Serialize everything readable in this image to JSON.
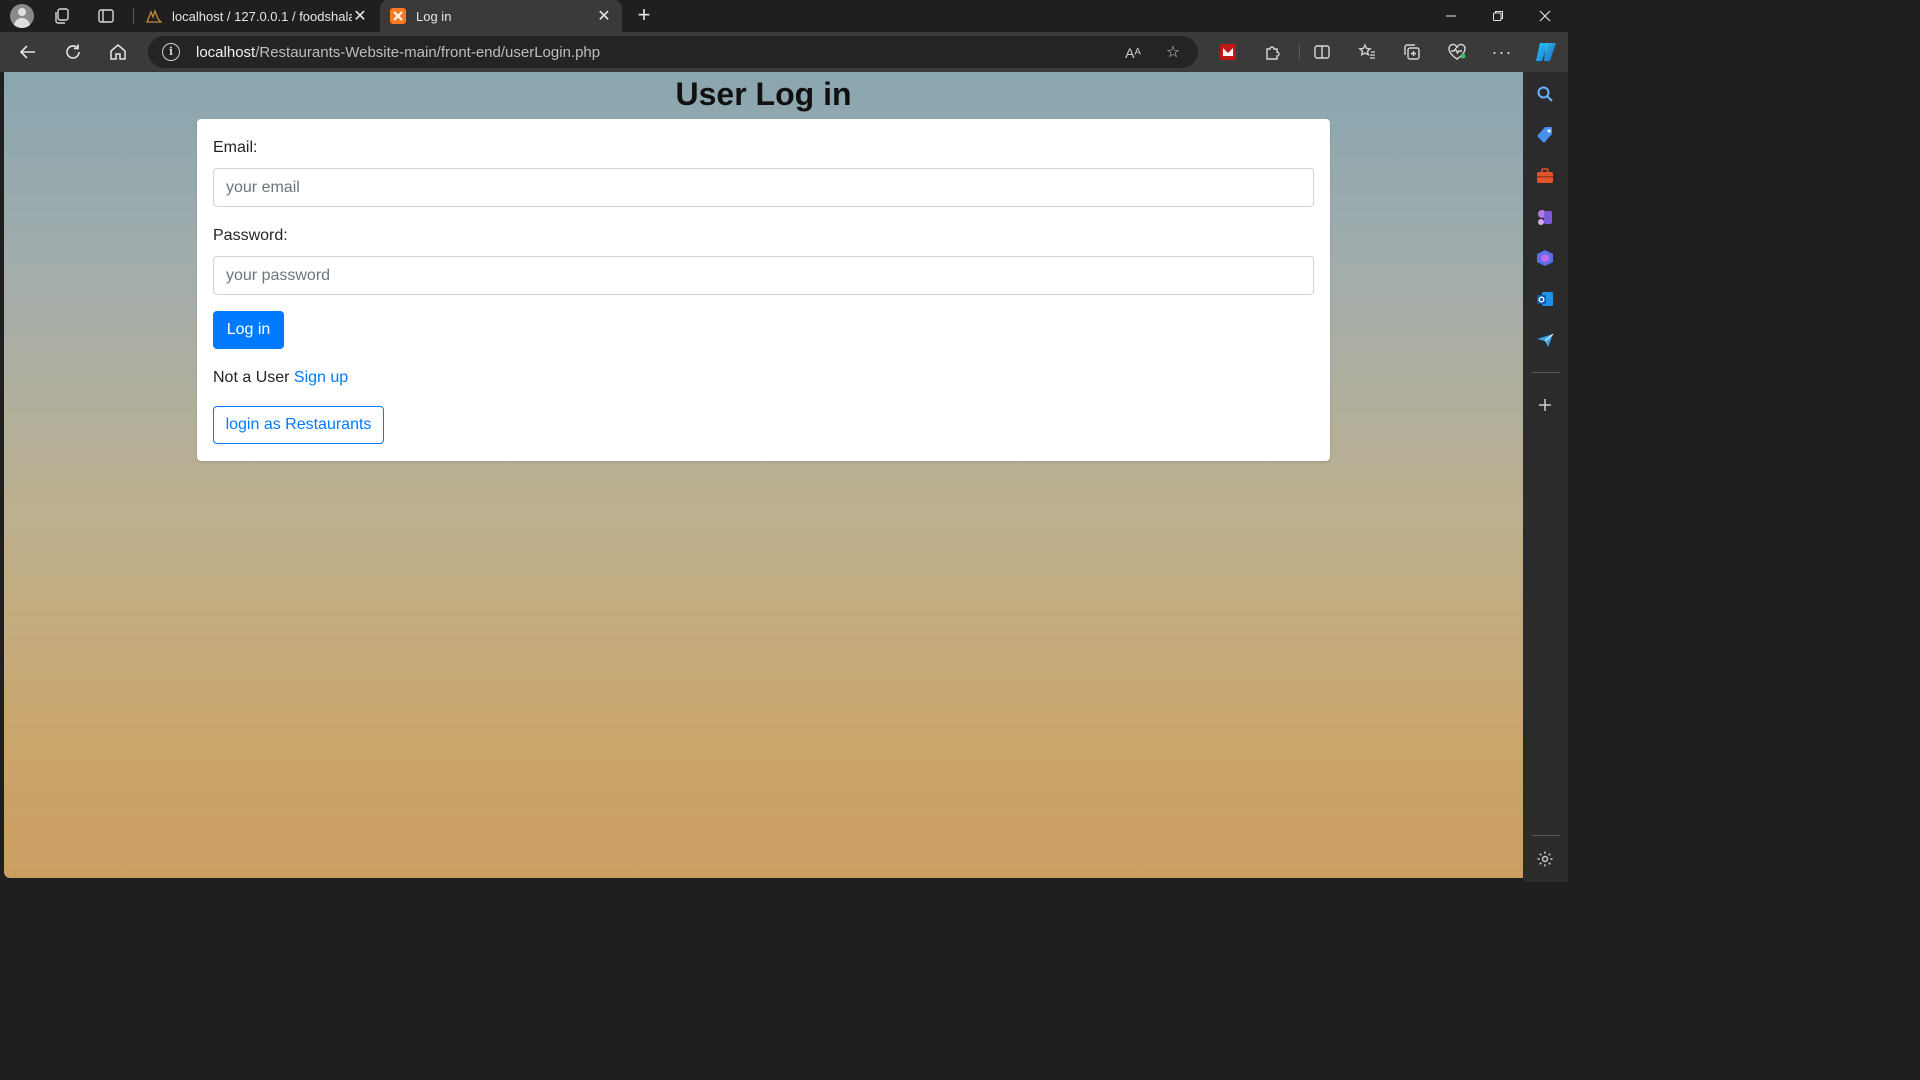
{
  "browser": {
    "tabs": [
      {
        "label": "localhost / 127.0.0.1 / foodshala",
        "icon": "phpmyadmin-icon",
        "active": false
      },
      {
        "label": "Log in",
        "icon": "xampp-icon",
        "active": true
      }
    ],
    "new_tab": "+",
    "address": {
      "host": "localhost",
      "path": "/Restaurants-Website-main/front-end/userLogin.php"
    },
    "read_aloud": "Aᴬ"
  },
  "page": {
    "title": "User Log in",
    "email": {
      "label": "Email:",
      "placeholder": "your email"
    },
    "password": {
      "label": "Password:",
      "placeholder": "your password"
    },
    "login_button": "Log in",
    "signup_prompt": "Not a User",
    "signup_link": "Sign up",
    "restaurant_button": "login as Restaurants"
  },
  "colors": {
    "primary": "#007bff",
    "text": "#212529",
    "chrome_dark": "#1f1f1f",
    "chrome_toolbar": "#3a3a3a"
  }
}
